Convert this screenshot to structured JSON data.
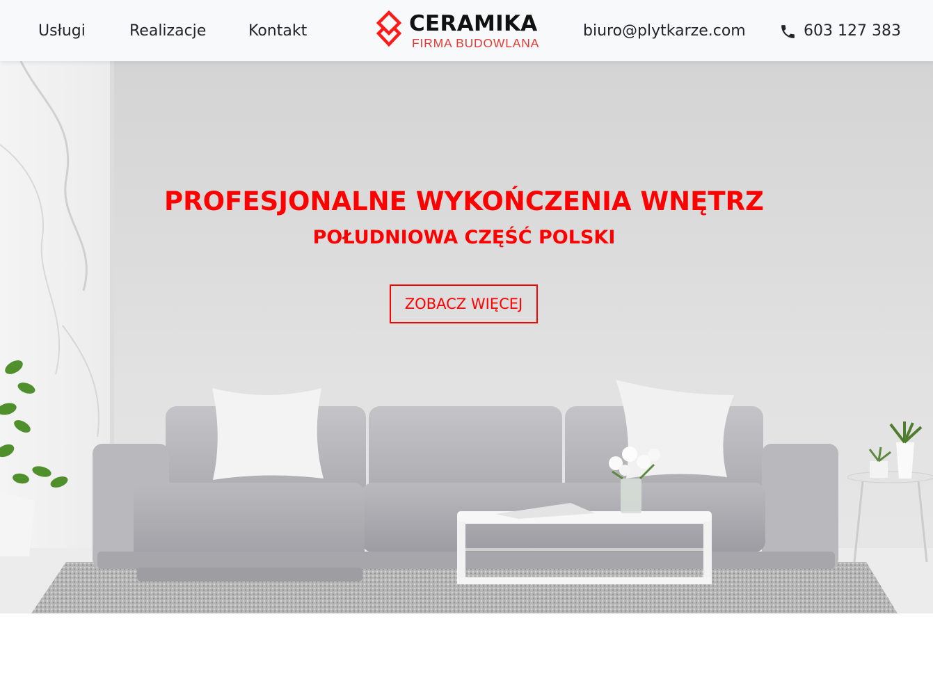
{
  "nav": {
    "links": [
      "Usługi",
      "Realizacje",
      "Kontakt"
    ],
    "email": "biuro@plytkarze.com",
    "phone": "603 127 383",
    "phone_icon": "phone-icon"
  },
  "logo": {
    "name": "CERAMIKA",
    "tagline": "FIRMA BUDOWLANA",
    "mark_icon": "diamond-logo-icon"
  },
  "hero": {
    "title": "PROFESJONALNE WYKOŃCZENIA WNĘTRZ",
    "subtitle": "POŁUDNIOWA CZĘŚĆ POLSKI",
    "cta_label": "ZOBACZ WIĘCEJ"
  },
  "colors": {
    "accent": "#ff0000",
    "logo_red": "#e53935",
    "nav_text": "#212529",
    "navbar_bg": "#f8f9fa"
  }
}
